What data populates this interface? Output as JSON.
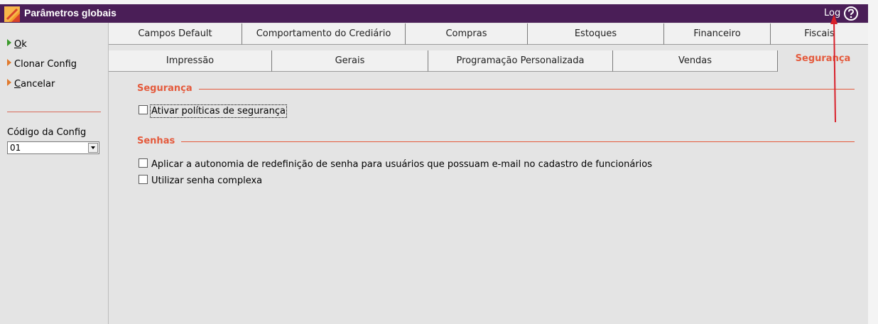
{
  "window": {
    "title": "Parâmetros globais",
    "log_label": "Log"
  },
  "sidebar": {
    "actions": [
      {
        "label_u": "O",
        "label_rest": "k"
      },
      {
        "label": "Clonar Config"
      },
      {
        "label_u": "C",
        "label_rest": "ancelar"
      }
    ],
    "config_label": "Código da Config",
    "config_value": "01"
  },
  "tabs": {
    "row1": [
      "Campos Default",
      "Comportamento do Crediário",
      "Compras",
      "Estoques",
      "Financeiro",
      "Fiscais"
    ],
    "row2": [
      "Impressão",
      "Gerais",
      "Programação Personalizada",
      "Vendas",
      "Segurança"
    ],
    "active": "Segurança"
  },
  "groups": {
    "seguranca": {
      "title": "Segurança",
      "options": [
        "Ativar políticas de segurança"
      ]
    },
    "senhas": {
      "title": "Senhas",
      "options": [
        "Aplicar a autonomia de redefinição de senha para usuários que possuam e-mail no cadastro de funcionários",
        "Utilizar senha complexa"
      ]
    }
  },
  "colors": {
    "titlebar": "#4a1e57",
    "accent": "#e45a3c",
    "panel": "#e4e4e4"
  }
}
